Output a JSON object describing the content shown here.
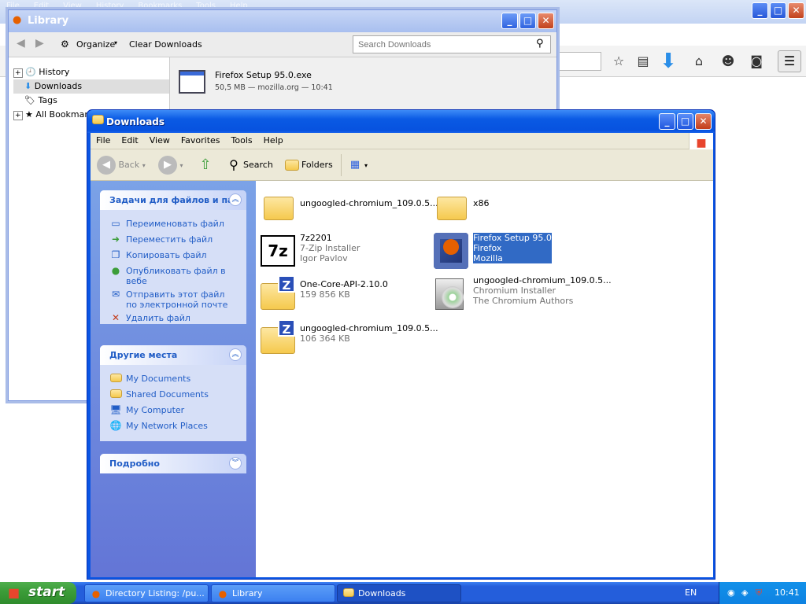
{
  "firefox": {
    "menu": [
      "File",
      "Edit",
      "View",
      "History",
      "Bookmarks",
      "Tools",
      "Help"
    ],
    "win_buttons": [
      "_",
      "□",
      "✕"
    ]
  },
  "library": {
    "title": "Library",
    "organize": "Organize",
    "clear_downloads": "Clear Downloads",
    "search_placeholder": "Search Downloads",
    "tree": [
      "History",
      "Downloads",
      "Tags",
      "All Bookmarks"
    ],
    "download": {
      "name": "Firefox Setup 95.0.exe",
      "meta": "50,5 MB — mozilla.org — 10:41"
    }
  },
  "explorer": {
    "title": "Downloads",
    "menu": [
      "File",
      "Edit",
      "View",
      "Favorites",
      "Tools",
      "Help"
    ],
    "toolbar": {
      "back": "Back",
      "search": "Search",
      "folders": "Folders"
    },
    "tasks_panel": {
      "title": "Задачи для файлов и пап",
      "items": [
        "Переименовать файл",
        "Переместить файл",
        "Копировать файл",
        "Опубликовать файл в вебе",
        "Отправить этот файл по электронной почте",
        "Удалить файл"
      ]
    },
    "places_panel": {
      "title": "Другие места",
      "items": [
        "My Documents",
        "Shared Documents",
        "My Computer",
        "My Network Places"
      ]
    },
    "details_panel": {
      "title": "Подробно"
    },
    "files": [
      {
        "name": "ungoogled-chromium_109.0.5...",
        "l2": "",
        "l3": ""
      },
      {
        "name": "x86",
        "l2": "",
        "l3": ""
      },
      {
        "name": "7z2201",
        "l2": "7-Zip Installer",
        "l3": "Igor Pavlov"
      },
      {
        "name": "Firefox Setup 95.0",
        "l2": "Firefox",
        "l3": "Mozilla"
      },
      {
        "name": "One-Core-API-2.10.0",
        "l2": "159 856 KB",
        "l3": ""
      },
      {
        "name": "ungoogled-chromium_109.0.5...",
        "l2": "Chromium Installer",
        "l3": "The Chromium Authors"
      },
      {
        "name": "ungoogled-chromium_109.0.5...",
        "l2": "106 364 KB",
        "l3": ""
      }
    ]
  },
  "taskbar": {
    "start": "start",
    "buttons": [
      "Directory Listing: /pu...",
      "Library",
      "Downloads"
    ],
    "lang": "EN",
    "clock": "10:41"
  }
}
